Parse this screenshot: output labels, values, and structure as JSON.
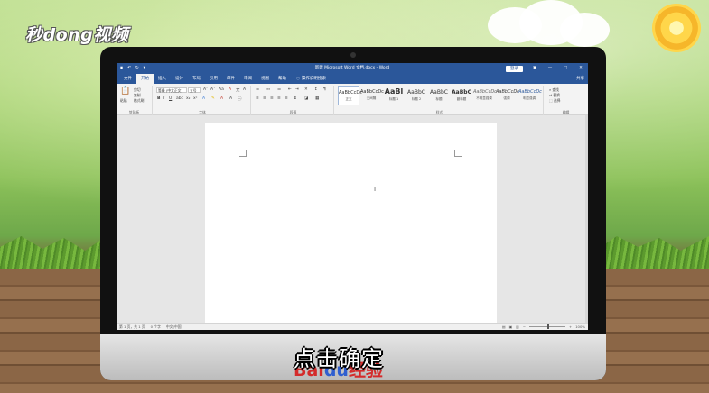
{
  "brand": {
    "logo_text": "秒dong视频"
  },
  "window": {
    "title": "新建 Microsoft Word 文档.docx - Word",
    "login_label": "登录",
    "controls": [
      "ribbon-display",
      "minimize",
      "maximize",
      "close"
    ]
  },
  "menubar": {
    "tabs": [
      "文件",
      "开始",
      "插入",
      "设计",
      "布局",
      "引用",
      "邮件",
      "审阅",
      "视图",
      "帮助"
    ],
    "active_tab": "开始",
    "tell_me": "操作说明搜索",
    "share": "共享"
  },
  "ribbon": {
    "clipboard": {
      "paste": "粘贴",
      "cut": "剪切",
      "copy": "复制",
      "format_painter": "格式刷",
      "label": "剪贴板"
    },
    "font": {
      "font_name": "等线 (中文正文)",
      "font_size": "五号",
      "label": "字体"
    },
    "paragraph": {
      "label": "段落"
    },
    "styles": {
      "items": [
        {
          "sample": "AaBbCcDc",
          "name": "正文"
        },
        {
          "sample": "AaBbCcDc",
          "name": "无间隔"
        },
        {
          "sample": "AaBl",
          "name": "标题 1"
        },
        {
          "sample": "AaBbC",
          "name": "标题 2"
        },
        {
          "sample": "AaBbC",
          "name": "标题"
        },
        {
          "sample": "AaBbC",
          "name": "副标题"
        },
        {
          "sample": "AaBbCcDc",
          "name": "不明显强调"
        },
        {
          "sample": "AaBbCcDc",
          "name": "强调"
        },
        {
          "sample": "AaBbCcDc",
          "name": "明显强调"
        }
      ],
      "selected_index": 0,
      "label": "样式"
    },
    "editing": {
      "find": "查找",
      "replace": "替换",
      "select": "选择",
      "label": "编辑"
    }
  },
  "statusbar": {
    "page": "第 1 页，共 1 页",
    "words": "0 个字",
    "language": "中文(中国)",
    "zoom": "100%"
  },
  "subtitle": "点击确定",
  "watermark": {
    "part1": "Bai",
    "part2": "du",
    "part3": "经验"
  },
  "colors": {
    "word_blue": "#2b579a",
    "ribbon_bg": "#f3f3f3",
    "page_bg": "#ffffff"
  }
}
